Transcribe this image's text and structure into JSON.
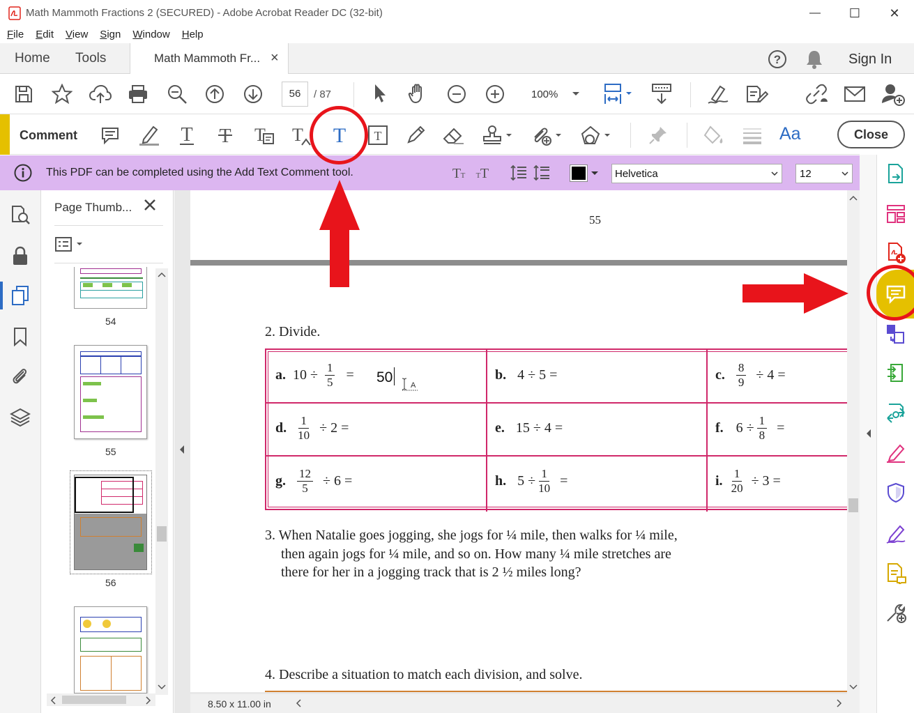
{
  "window": {
    "title": "Math Mammoth Fractions 2 (SECURED) - Adobe Acrobat Reader DC (32-bit)",
    "controls": [
      "—",
      "☐",
      "✕"
    ]
  },
  "menu": [
    "File",
    "Edit",
    "View",
    "Sign",
    "Window",
    "Help"
  ],
  "tabs": {
    "home": "Home",
    "tools": "Tools",
    "document": "Math Mammoth Fr...",
    "close_glyph": "×",
    "sign_in": "Sign In"
  },
  "toolbar": {
    "current_page": "56",
    "page_total": "/ 87",
    "zoom": "100%"
  },
  "comment_toolbar": {
    "label": "Comment",
    "font_button": "Aa",
    "close_label": "Close",
    "accent_color": "#e5c000"
  },
  "info_bar": {
    "message": "This PDF can be completed using the Add Text Comment tool.",
    "font": "Helvetica",
    "font_size": "12",
    "background_color": "#dcb6f0"
  },
  "thumbnails": {
    "title": "Page Thumb...",
    "pages": [
      "54",
      "55",
      "56"
    ]
  },
  "document": {
    "page_number": "55",
    "problem2_heading": "2. Divide.",
    "cells": [
      {
        "letter": "a.",
        "pre": "10 ÷",
        "num": "1",
        "den": "5",
        "post": "=",
        "answer": "50"
      },
      {
        "letter": "b.",
        "pre": "4 ÷ 5 =",
        "num": "",
        "den": "",
        "post": ""
      },
      {
        "letter": "c.",
        "pre": "",
        "num": "8",
        "den": "9",
        "post": "÷ 4 ="
      },
      {
        "letter": "d.",
        "pre": "",
        "num": "1",
        "den": "10",
        "post": "÷ 2 ="
      },
      {
        "letter": "e.",
        "pre": "15 ÷ 4 =",
        "num": "",
        "den": "",
        "post": ""
      },
      {
        "letter": "f.",
        "pre": "6 ÷",
        "num": "1",
        "den": "8",
        "post": "="
      },
      {
        "letter": "g.",
        "pre": "",
        "num": "12",
        "den": "5",
        "post": "÷ 6 ="
      },
      {
        "letter": "h.",
        "pre": "5 ÷",
        "num": "1",
        "den": "10",
        "post": "="
      },
      {
        "letter": "i.",
        "pre": "",
        "num": "1",
        "den": "20",
        "post": "÷ 3 ="
      }
    ],
    "problem3_lines": [
      "3. When Natalie goes jogging, she jogs for ¼ mile, then walks for ¼ mile,",
      "then again jogs for ¼ mile, and so on. How many ¼ mile stretches are",
      "there for her in a jogging track that is 2 ½ miles long?"
    ],
    "problem4_heading": "4. Describe a situation to match each division, and solve.",
    "page_size": "8.50 x 11.00 in",
    "table_border_color": "#d0286a"
  },
  "annotation_color": "#e8141b"
}
